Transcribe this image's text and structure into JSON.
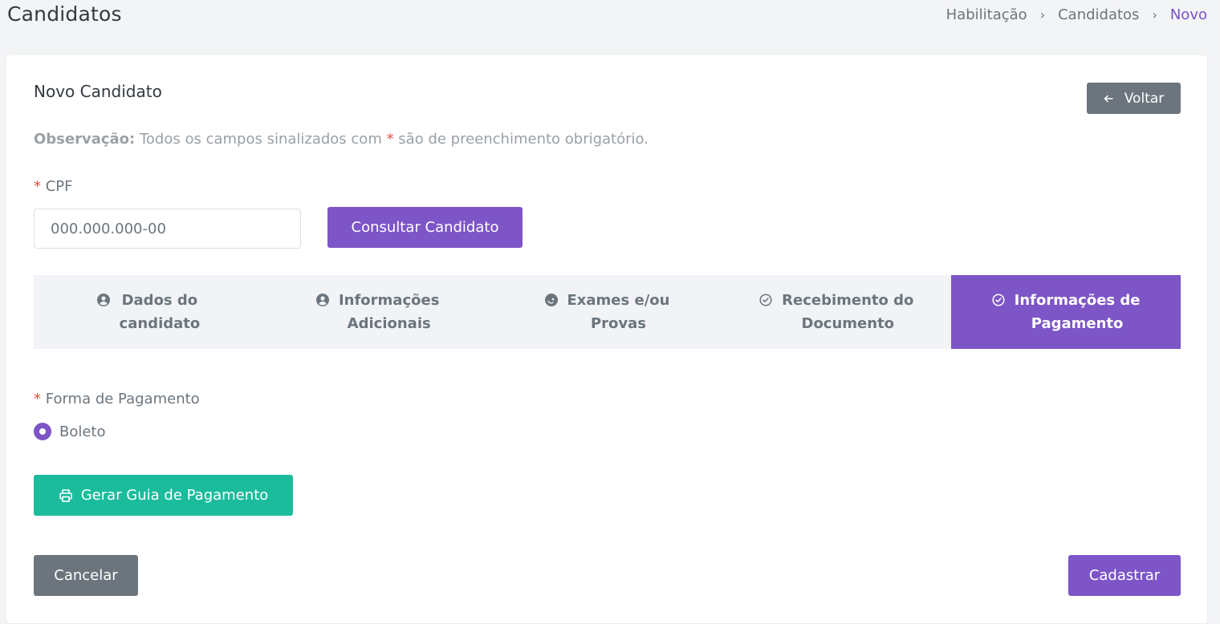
{
  "header": {
    "title": "Candidatos",
    "breadcrumb": [
      "Habilitação",
      "Candidatos",
      "Novo"
    ],
    "breadcrumb_separator": "›"
  },
  "card": {
    "title": "Novo Candidato",
    "back_label": "Voltar",
    "observation_strong": "Observação:",
    "observation_text_before": " Todos os campos sinalizados com ",
    "observation_required_mark": "*",
    "observation_text_after": " são de preenchimento obrigatório."
  },
  "cpf": {
    "required_mark": "*",
    "label": "CPF",
    "placeholder": "000.000.000-00",
    "consult_label": "Consultar Candidato"
  },
  "tabs": [
    {
      "line1": "Dados do",
      "line2": "candidato",
      "icon": "user-circle-icon"
    },
    {
      "line1": "Informações",
      "line2": "Adicionais",
      "icon": "user-circle-icon"
    },
    {
      "line1": "Exames e/ou",
      "line2": "Provas",
      "icon": "face-icon"
    },
    {
      "line1": "Recebimento do",
      "line2": "Documento",
      "icon": "check-circle-icon"
    },
    {
      "line1": "Informações de",
      "line2": "Pagamento",
      "icon": "check-circle-icon"
    }
  ],
  "active_tab_index": 4,
  "payment": {
    "required_mark": "*",
    "label": "Forma de Pagamento",
    "option_selected": "Boleto",
    "generate_label": "Gerar Guia de Pagamento"
  },
  "footer": {
    "cancel_label": "Cancelar",
    "submit_label": "Cadastrar"
  },
  "colors": {
    "primary": "#7d55c7",
    "secondary": "#6c757d",
    "success": "#1abc9c",
    "required": "#e74c3c"
  }
}
